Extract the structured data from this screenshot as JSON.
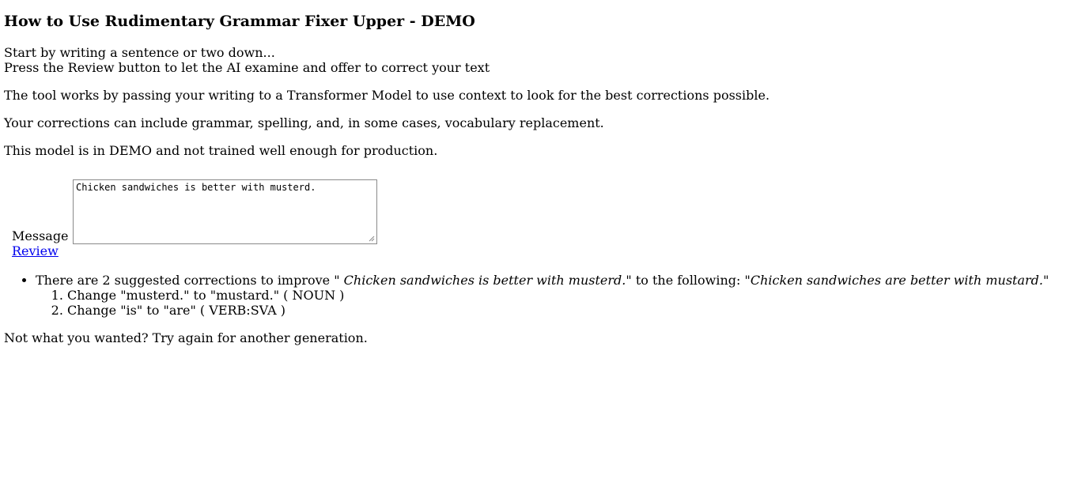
{
  "page": {
    "title": "How to Use Rudimentary Grammar Fixer Upper - DEMO",
    "intro_line1": "Start by writing a sentence or two down...",
    "intro_line2": "Press the Review button to let the AI examine and offer to correct your text",
    "para_tool": "The tool works by passing your writing to a Transformer Model to use context to look for the best corrections possible.",
    "para_corrections": "Your corrections can include grammar, spelling, and, in some cases, vocabulary replacement.",
    "para_demo": "This model is in DEMO and not trained well enough for production."
  },
  "form": {
    "message_label": "Message",
    "message_value": "Chicken sandwiches is better with musterd.",
    "review_label": "Review"
  },
  "results": {
    "summary_prefix": "There are 2 suggested corrections to improve \"",
    "original_text": " Chicken sandwiches is better with musterd.",
    "summary_middle": "\" to the following: \"",
    "corrected_text": "Chicken sandwiches are better with mustard.",
    "summary_suffix": "\"",
    "corrections": [
      {
        "text": "Change \"musterd.\" to \"mustard.\" ( NOUN )"
      },
      {
        "text": "Change \"is\" to \"are\" ( VERB:SVA )"
      }
    ],
    "retry_text": "Not what you wanted? Try again for another generation."
  },
  "colors": {
    "link": "#0000ee",
    "spellcheck_underline": "#e01b1b",
    "textarea_border": "#8a8a8a"
  }
}
